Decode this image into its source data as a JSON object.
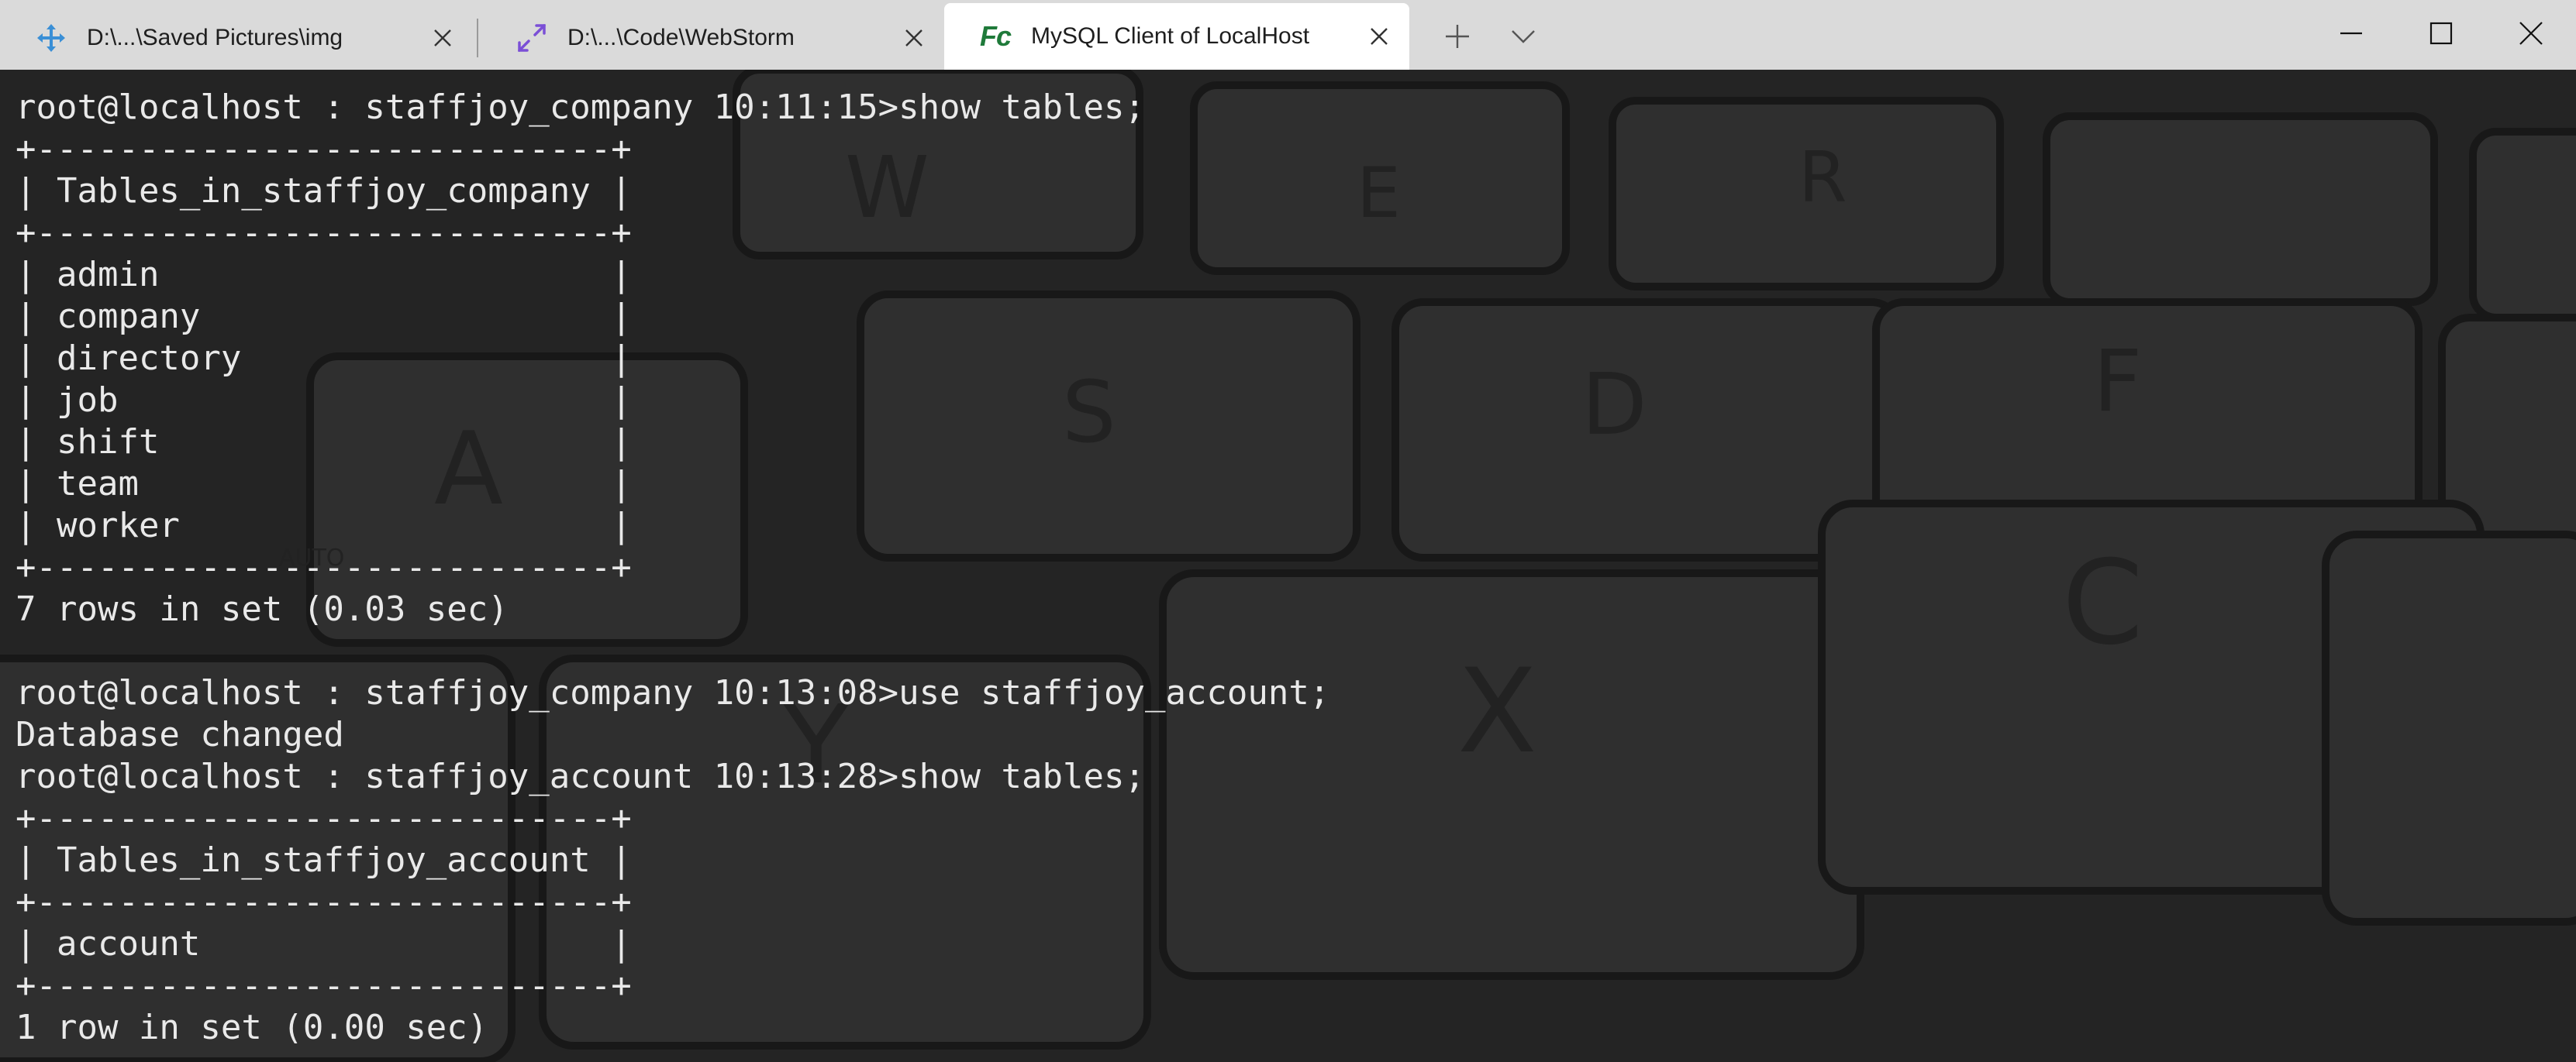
{
  "tabs": [
    {
      "title": "D:\\...\\Saved Pictures\\img",
      "icon": "move-arrows-icon",
      "active": false
    },
    {
      "title": "D:\\...\\Code\\WebStorm",
      "icon": "expand-arrows-icon",
      "active": false
    },
    {
      "title": "MySQL Client of LocalHost",
      "icon": "fc-logo-icon",
      "logo_text": "Fc",
      "active": true
    }
  ],
  "colors": {
    "titlebar": "#dadada",
    "active_tab": "#ffffff",
    "terminal_text": "#e9e9e9",
    "fc_logo": "#1f7a3a",
    "move_icon": "#3a8fd6",
    "expand_icon": "#7b4fd6"
  },
  "terminal": {
    "lines": [
      "root@localhost : staffjoy_company 10:11:15>show tables;",
      "+----------------------------+",
      "| Tables_in_staffjoy_company |",
      "+----------------------------+",
      "| admin                      |",
      "| company                    |",
      "| directory                  |",
      "| job                        |",
      "| shift                      |",
      "| team                       |",
      "| worker                     |",
      "+----------------------------+",
      "7 rows in set (0.03 sec)",
      "",
      "root@localhost : staffjoy_company 10:13:08>use staffjoy_account;",
      "Database changed",
      "root@localhost : staffjoy_account 10:13:28>show tables;",
      "+----------------------------+",
      "| Tables_in_staffjoy_account |",
      "+----------------------------+",
      "| account                    |",
      "+----------------------------+",
      "1 row in set (0.00 sec)"
    ]
  },
  "background": {
    "key_letters": [
      "W",
      "E",
      "R",
      "S",
      "D",
      "F",
      "A",
      "X",
      "C",
      "Y"
    ],
    "key_label_auto": "AUTO"
  }
}
